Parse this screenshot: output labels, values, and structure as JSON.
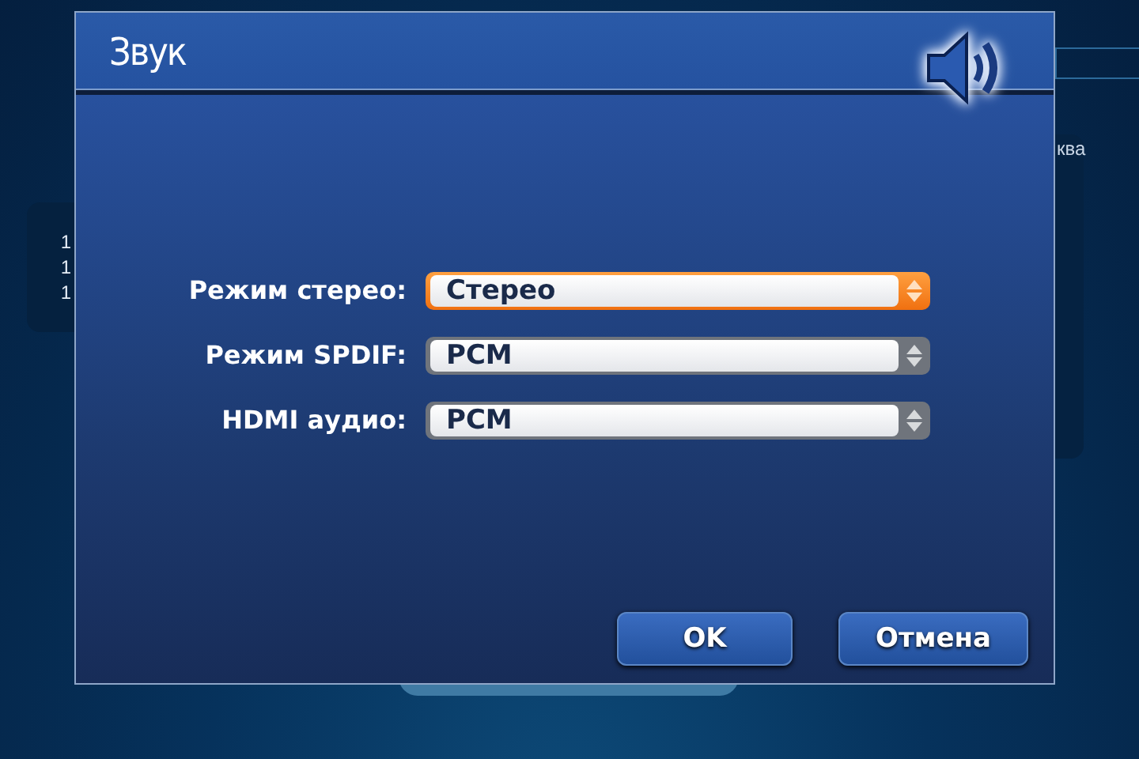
{
  "background": {
    "left_panel": [
      "1",
      "1",
      "1"
    ],
    "right_panel": "ква"
  },
  "dialog": {
    "title": "Звук",
    "fields": [
      {
        "label": "Режим стерео:",
        "value": "Стерео",
        "focused": true
      },
      {
        "label": "Режим SPDIF:",
        "value": "PCM",
        "focused": false
      },
      {
        "label": "HDMI аудио:",
        "value": "PCM",
        "focused": false
      }
    ],
    "buttons": [
      {
        "label": "OK"
      },
      {
        "label": "Отмена"
      }
    ]
  }
}
